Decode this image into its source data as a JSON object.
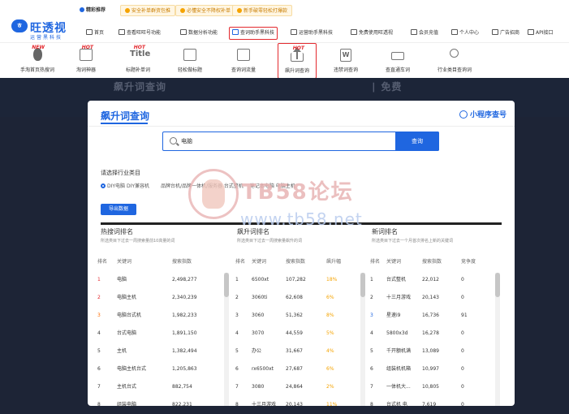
{
  "header": {
    "logo_name": "旺透视",
    "logo_sub": "运营黑科技",
    "logo_glyph": "ㅎ",
    "recommend_label": "精彩推荐",
    "promos": [
      "安全补单群资包推",
      "必懂安全不降权补单",
      "新手破零轻松打爆款"
    ]
  },
  "nav": [
    {
      "label": "首页",
      "icon": "home-icon"
    },
    {
      "label": "查看旺旺号功能",
      "icon": "id-card-icon"
    },
    {
      "label": "数据分析功能",
      "icon": "chart-icon"
    },
    {
      "label": "查词助手黑科技",
      "icon": "search-doc-icon",
      "active": true
    },
    {
      "label": "运营助手黑科技",
      "icon": "tools-icon"
    },
    {
      "label": "免费使用旺透视",
      "icon": "gift-icon"
    },
    {
      "label": "会员充值",
      "icon": "diamond-icon"
    },
    {
      "label": "个人中心",
      "icon": "user-icon"
    },
    {
      "label": "广告招商",
      "icon": "ad-icon"
    },
    {
      "label": "API接口",
      "icon": "api-icon"
    }
  ],
  "tools": [
    {
      "label": "手淘首页热搜词",
      "badge": "NEW",
      "icon": "flame-icon"
    },
    {
      "label": "淘词神器",
      "badge": "HOT",
      "icon": "book-icon"
    },
    {
      "label": "标题补单词",
      "badge": "HOT",
      "icon": "title-icon"
    },
    {
      "label": "轻松做标题",
      "badge": "",
      "icon": "list-icon"
    },
    {
      "label": "查询词流量",
      "badge": "",
      "icon": "analytics-icon"
    },
    {
      "label": "飙升词查询",
      "badge": "HOT",
      "icon": "upload-icon",
      "active": true
    },
    {
      "label": "违禁词查询",
      "badge": "",
      "icon": "w-doc-icon"
    },
    {
      "label": "查直通车词",
      "badge": "",
      "icon": "car-icon"
    },
    {
      "label": "行业类目查询词",
      "badge": "",
      "icon": "magnify-list-icon"
    }
  ],
  "hero_text": "飙升词查询　　　　　　　　　　　　　　　　　　　  ∣ 免费",
  "page": {
    "title": "飙升词查询",
    "mini_program": "小程序查号",
    "search_value": "电脑",
    "search_button": "查询",
    "category_label": "请选择行业类目",
    "categories": [
      {
        "label": "DIY电脑 DIY兼容机",
        "selected": true
      },
      {
        "label": "品牌台机/品牌一体机/服务器 台式整机",
        "selected": false
      },
      {
        "label": "笔记本电脑 电脑主机",
        "selected": false
      }
    ],
    "export_button": "导出数据"
  },
  "watermark": {
    "line1": "TB58论坛",
    "line2": "www.tb58.net"
  },
  "panels": {
    "hot": {
      "title": "热搜词排名",
      "sub": "所选类目下过去一周搜索量前10高量的词",
      "headers": [
        "排名",
        "关键词",
        "搜索指数"
      ],
      "rows": [
        [
          "1",
          "电脑",
          "2,498,277"
        ],
        [
          "2",
          "电脑主机",
          "2,340,239"
        ],
        [
          "3",
          "电脑台式机",
          "1,982,233"
        ],
        [
          "4",
          "台式电脑",
          "1,891,150"
        ],
        [
          "5",
          "主机",
          "1,382,494"
        ],
        [
          "6",
          "电脑主机台式",
          "1,205,863"
        ],
        [
          "7",
          "主机台式",
          "882,754"
        ],
        [
          "8",
          "组装电脑",
          "822,231"
        ]
      ]
    },
    "rising": {
      "title": "飙升词排名",
      "sub": "所选类目下过去一周搜索量飙升的词",
      "headers": [
        "排名",
        "关键词",
        "搜索指数",
        "飙升幅"
      ],
      "rows": [
        [
          "1",
          "6500xt",
          "107,282",
          "18%"
        ],
        [
          "2",
          "3060ti",
          "62,608",
          "6%"
        ],
        [
          "3",
          "3060",
          "51,362",
          "8%"
        ],
        [
          "4",
          "3070",
          "44,559",
          "5%"
        ],
        [
          "5",
          "办公",
          "31,667",
          "4%"
        ],
        [
          "6",
          "rx6500xt",
          "27,687",
          "6%"
        ],
        [
          "7",
          "3080",
          "24,864",
          "2%"
        ],
        [
          "8",
          "十三月游戏",
          "20,143",
          "11%"
        ]
      ]
    },
    "new": {
      "title": "新词排名",
      "sub": "所选类目下过去一个月首次排名上新的关键词",
      "headers": [
        "排名",
        "关键词",
        "搜索指数",
        "竞争度"
      ],
      "rows": [
        [
          "1",
          "台式整机",
          "22,012",
          "0"
        ],
        [
          "2",
          "十三月游戏",
          "20,143",
          "0"
        ],
        [
          "3",
          "星速i9",
          "16,736",
          "91"
        ],
        [
          "4",
          "5800x3d",
          "16,278",
          "0"
        ],
        [
          "5",
          "千开额机满",
          "13,089",
          "0"
        ],
        [
          "6",
          "组装机机箱",
          "10,997",
          "0"
        ],
        [
          "7",
          "一体机大...",
          "10,805",
          "0"
        ],
        [
          "8",
          "台式机 电",
          "7,619",
          "0"
        ]
      ]
    }
  },
  "colors": {
    "accent": "#1f66e0",
    "highlight": "#e3292e",
    "percent": "#f5a300"
  }
}
